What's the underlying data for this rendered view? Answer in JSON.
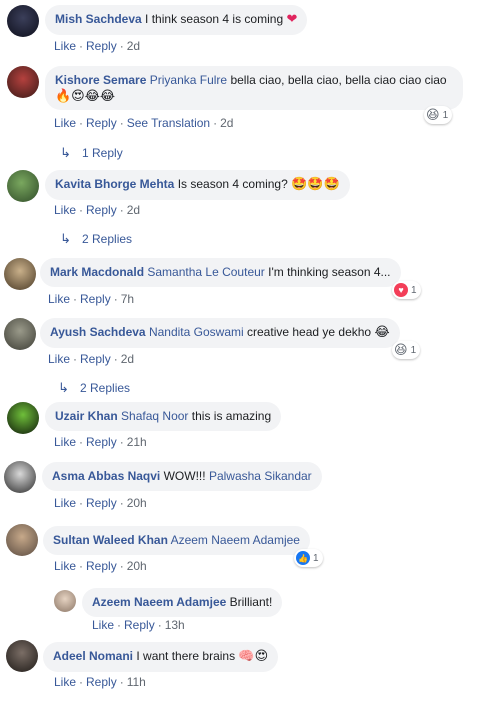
{
  "comments": [
    {
      "name": "Mish Sachdeva",
      "tag": "",
      "text": "I think season 4 is coming",
      "emoji": "❤",
      "like": "Like",
      "reply": "Reply",
      "time": "2d"
    },
    {
      "name": "Kishore Semare",
      "tag": "Priyanka Fulre",
      "text": "bella ciao, bella ciao, bella ciao ciao ciao",
      "emoji": "🔥😍😂😂",
      "like": "Like",
      "reply": "Reply",
      "translate": "See Translation",
      "time": "2d",
      "reaction_count": "1",
      "replies": "1 Reply"
    },
    {
      "name": "Kavita Bhorge Mehta",
      "tag": "",
      "text": "Is season 4 coming?",
      "emoji": "🤩🤩🤩",
      "like": "Like",
      "reply": "Reply",
      "time": "2d",
      "replies": "2 Replies"
    },
    {
      "name": "Mark Macdonald",
      "tag": "Samantha Le Couteur",
      "text": "I'm thinking season 4...",
      "like": "Like",
      "reply": "Reply",
      "time": "7h",
      "reaction_count": "1"
    },
    {
      "name": "Ayush Sachdeva",
      "tag": "Nandita Goswami",
      "text": "creative head ye dekho",
      "emoji": "😂",
      "like": "Like",
      "reply": "Reply",
      "time": "2d",
      "reaction_count": "1",
      "replies": "2 Replies"
    },
    {
      "name": "Uzair Khan",
      "tag": "Shafaq Noor",
      "text": "this is amazing",
      "like": "Like",
      "reply": "Reply",
      "time": "21h"
    },
    {
      "name": "Asma Abbas Naqvi",
      "tag": "",
      "text": "WOW!!!",
      "tag_after": "Palwasha Sikandar",
      "like": "Like",
      "reply": "Reply",
      "time": "20h"
    },
    {
      "name": "Sultan Waleed Khan",
      "tag": "Azeem Naeem Adamjee",
      "text": "",
      "like": "Like",
      "reply": "Reply",
      "time": "20h",
      "reaction_count": "1"
    },
    {
      "name": "Azeem Naeem Adamjee",
      "tag": "",
      "text": "Brilliant!",
      "like": "Like",
      "reply": "Reply",
      "time": "13h"
    },
    {
      "name": "Adeel Nomani",
      "tag": "",
      "text": "I want there brains",
      "emoji": "🧠😍",
      "like": "Like",
      "reply": "Reply",
      "time": "11h"
    }
  ],
  "colors": {
    "link": "#385898",
    "bubble": "#f2f3f5",
    "meta": "#606770"
  },
  "icons": [
    "reply-arrow-icon",
    "haha-reaction-icon",
    "love-reaction-icon",
    "like-reaction-icon"
  ]
}
